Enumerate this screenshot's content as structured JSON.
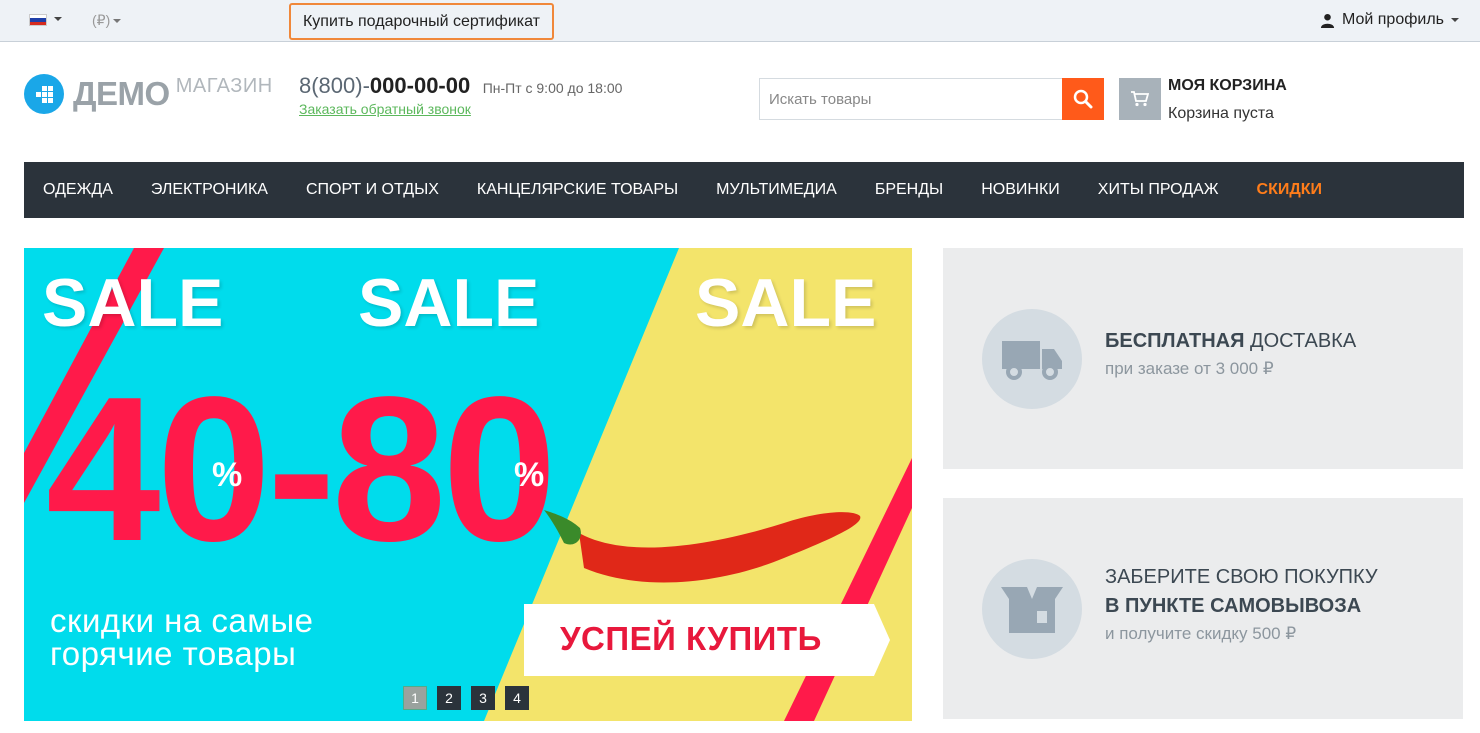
{
  "topbar": {
    "language_flag": "russian-flag",
    "currency": "(₽)",
    "gift_certificate": "Купить подарочный сертификат",
    "profile": "Мой профиль"
  },
  "header": {
    "logo_main": "ДЕМО",
    "logo_sub": "МАГАЗИН",
    "phone_prefix": "8(800)-",
    "phone_number": "000-00-00",
    "hours": "Пн-Пт с 9:00 до 18:00",
    "callback": "Заказать обратный звонок",
    "search_placeholder": "Искать товары",
    "cart_title": "МОЯ КОРЗИНА",
    "cart_status": "Корзина пуста"
  },
  "nav": {
    "items": [
      "ОДЕЖДА",
      "ЭЛЕКТРОНИКА",
      "СПОРТ И ОТДЫХ",
      "КАНЦЕЛЯРСКИЕ ТОВАРЫ",
      "МУЛЬТИМЕДИА",
      "БРЕНДЫ",
      "НОВИНКИ",
      "ХИТЫ ПРОДАЖ"
    ],
    "highlight": "СКИДКИ"
  },
  "banner": {
    "sale_word": "SALE",
    "ribbon_word": "SALE",
    "discount": "40-80",
    "percent": "%",
    "slogan_line1": "скидки на самые",
    "slogan_line2": "горячие товары",
    "cta": "УСПЕЙ КУПИТЬ",
    "slides": [
      "1",
      "2",
      "3",
      "4"
    ],
    "active_slide": 1
  },
  "promos": {
    "delivery": {
      "title_bold": "БЕСПЛАТНАЯ",
      "title_rest": " ДОСТАВКА",
      "subtitle": "при заказе от 3 000 ₽"
    },
    "pickup": {
      "line1": "ЗАБЕРИТЕ СВОЮ ПОКУПКУ",
      "line2": "В ПУНКТЕ САМОВЫВОЗА",
      "subtitle": "и получите скидку 500 ₽"
    }
  },
  "colors": {
    "accent_orange": "#ff5a1a",
    "nav_bg": "#2b333b",
    "nav_highlight": "#ff7d1a",
    "banner_cyan": "#00dcec",
    "banner_yellow": "#f3e46b",
    "banner_red": "#ff1a4a",
    "callback_green": "#5cb85c"
  }
}
